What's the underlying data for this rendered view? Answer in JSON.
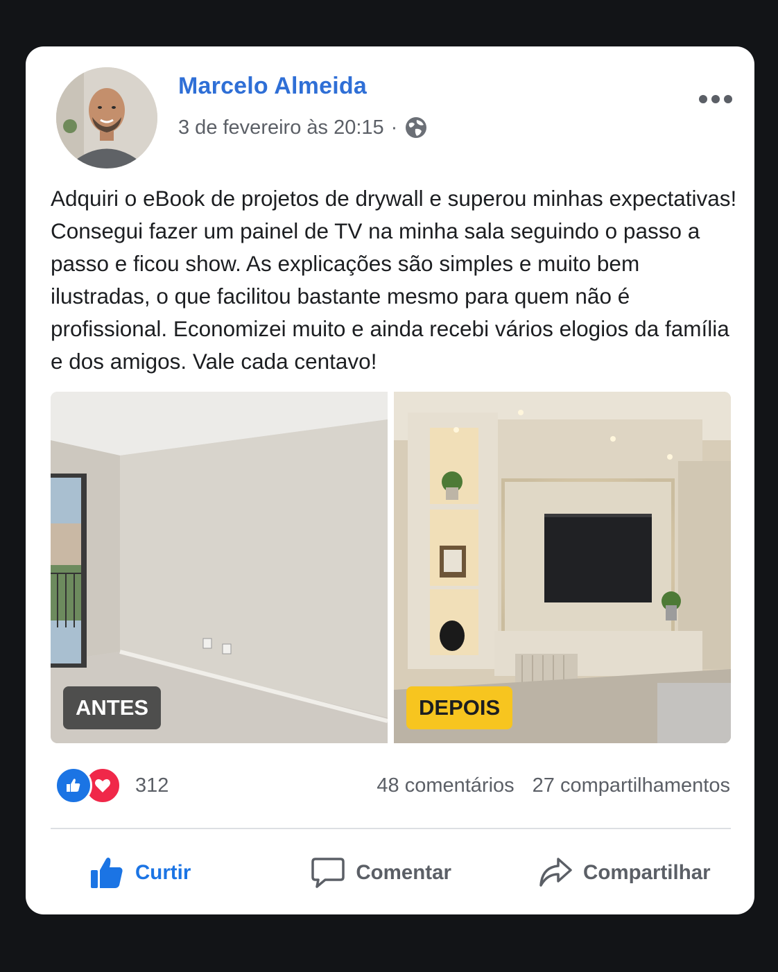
{
  "post": {
    "author": "Marcelo Almeida",
    "timestamp": "3 de fevereiro às 20:15",
    "separator": "·",
    "privacy_icon": "globe-icon",
    "body": "Adquiri o eBook de projetos de drywall e superou minhas expectativas! Consegui fazer um painel de TV na minha sala seguindo o passo a passo e ficou show. As explicações são simples e muito bem ilustradas, o que facilitou bastante mesmo para quem não é profissional. Economizei muito e ainda recebi vários elogios da família e dos amigos. Vale cada centavo!"
  },
  "photos": {
    "before_label": "ANTES",
    "after_label": "DEPOIS"
  },
  "stats": {
    "reactions_count": "312",
    "comments": "48 comentários",
    "shares": "27 compartilhamentos"
  },
  "actions": {
    "like": "Curtir",
    "comment": "Comentar",
    "share": "Compartilhar"
  },
  "colors": {
    "author_blue": "#2f6fd6",
    "like_blue": "#1b74e4",
    "love_red": "#f02849",
    "after_tag_yellow": "#f7c51f",
    "background": "#121417"
  }
}
